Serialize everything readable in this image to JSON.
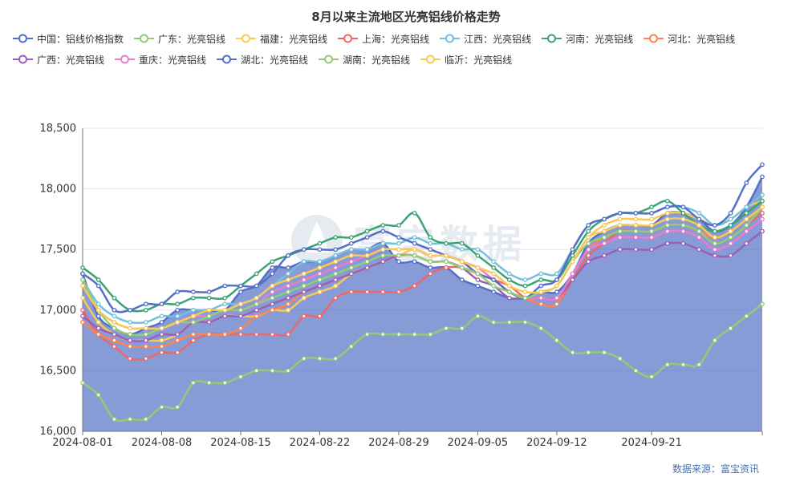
{
  "title": "8月以来主流地区光亮铝线价格走势",
  "source_text": "数据来源：富宝资讯",
  "watermark_text": "富宝数据",
  "chart_data": {
    "type": "line",
    "title": "8月以来主流地区光亮铝线价格走势",
    "xlabel": "",
    "ylabel": "",
    "ylim": [
      16000,
      18500
    ],
    "yticks": [
      16000,
      16500,
      17000,
      17500,
      18000,
      18500
    ],
    "ytick_labels": [
      "16,000",
      "16,500",
      "17,000",
      "17,500",
      "18,000",
      "18,500"
    ],
    "xtick_labels": [
      "2024-08-01",
      "2024-08-08",
      "2024-08-15",
      "2024-08-22",
      "2024-08-29",
      "2024-09-05",
      "2024-09-12",
      "2024-09-21"
    ],
    "xtick_index": [
      0,
      5,
      10,
      15,
      20,
      25,
      30,
      36
    ],
    "grid": true,
    "legend_position": "top",
    "area_series": "中国：铝线价格指数",
    "dates": [
      "2024-08-01",
      "2024-08-02",
      "2024-08-05",
      "2024-08-06",
      "2024-08-07",
      "2024-08-08",
      "2024-08-09",
      "2024-08-12",
      "2024-08-13",
      "2024-08-14",
      "2024-08-15",
      "2024-08-16",
      "2024-08-19",
      "2024-08-20",
      "2024-08-21",
      "2024-08-22",
      "2024-08-23",
      "2024-08-26",
      "2024-08-27",
      "2024-08-28",
      "2024-08-29",
      "2024-08-30",
      "2024-09-02",
      "2024-09-03",
      "2024-09-04",
      "2024-09-05",
      "2024-09-06",
      "2024-09-09",
      "2024-09-10",
      "2024-09-11",
      "2024-09-12",
      "2024-09-13",
      "2024-09-14",
      "2024-09-18",
      "2024-09-19",
      "2024-09-20",
      "2024-09-21",
      "2024-09-23",
      "2024-09-24",
      "2024-09-25",
      "2024-09-26",
      "2024-09-27",
      "2024-09-29",
      "2024-09-30"
    ],
    "series": [
      {
        "name": "中国：铝线价格指数",
        "color": "#5470c6",
        "values": [
          17300,
          16950,
          16850,
          16800,
          16850,
          16900,
          17000,
          17000,
          17000,
          17000,
          17150,
          17200,
          17350,
          17350,
          17400,
          17400,
          17450,
          17500,
          17500,
          17550,
          17400,
          17400,
          17350,
          17350,
          17250,
          17200,
          17150,
          17100,
          17100,
          17150,
          17150,
          17300,
          17550,
          17650,
          17700,
          17700,
          17700,
          17800,
          17800,
          17750,
          17650,
          17700,
          17850,
          18100
        ]
      },
      {
        "name": "广东：光亮铝线",
        "color": "#91cc75",
        "values": [
          16400,
          16300,
          16100,
          16100,
          16100,
          16200,
          16200,
          16400,
          16400,
          16400,
          16450,
          16500,
          16500,
          16500,
          16600,
          16600,
          16600,
          16700,
          16800,
          16800,
          16800,
          16800,
          16800,
          16850,
          16850,
          16950,
          16900,
          16900,
          16900,
          16850,
          16750,
          16650,
          16650,
          16650,
          16600,
          16500,
          16450,
          16550,
          16550,
          16550,
          16750,
          16850,
          16950,
          17050
        ]
      },
      {
        "name": "福建：光亮铝线",
        "color": "#fac858",
        "values": [
          17100,
          16900,
          16800,
          16750,
          16750,
          16750,
          16800,
          16900,
          16900,
          16950,
          16950,
          16950,
          17000,
          17000,
          17100,
          17150,
          17200,
          17300,
          17350,
          17400,
          17450,
          17500,
          17450,
          17450,
          17400,
          17350,
          17300,
          17200,
          17150,
          17150,
          17200,
          17400,
          17600,
          17700,
          17750,
          17750,
          17750,
          17800,
          17800,
          17750,
          17700,
          17750,
          17850,
          17900
        ]
      },
      {
        "name": "上海：光亮铝线",
        "color": "#ee6666",
        "values": [
          17000,
          16800,
          16700,
          16600,
          16600,
          16650,
          16650,
          16750,
          16800,
          16800,
          16800,
          16800,
          16800,
          16800,
          16950,
          16950,
          17100,
          17150,
          17150,
          17150,
          17150,
          17200,
          17300,
          17350,
          17350,
          17300,
          17250,
          17200,
          17100,
          17050,
          17050,
          17250,
          17450,
          17550,
          17650,
          17650,
          17650,
          17700,
          17700,
          17650,
          17550,
          17600,
          17700,
          17800
        ]
      },
      {
        "name": "江西：光亮铝线",
        "color": "#73c0de",
        "values": [
          17250,
          17050,
          16950,
          16900,
          16900,
          16950,
          16950,
          17000,
          17000,
          17050,
          17050,
          17100,
          17200,
          17300,
          17400,
          17400,
          17450,
          17500,
          17500,
          17550,
          17550,
          17600,
          17550,
          17550,
          17500,
          17500,
          17400,
          17300,
          17250,
          17300,
          17300,
          17500,
          17700,
          17750,
          17800,
          17800,
          17800,
          17850,
          17850,
          17800,
          17700,
          17750,
          17850,
          17950
        ]
      },
      {
        "name": "河南：光亮铝线",
        "color": "#3ba272",
        "values": [
          17350,
          17250,
          17100,
          17000,
          17000,
          17050,
          17050,
          17100,
          17100,
          17100,
          17200,
          17300,
          17400,
          17450,
          17500,
          17550,
          17600,
          17600,
          17650,
          17700,
          17700,
          17800,
          17600,
          17550,
          17550,
          17450,
          17350,
          17250,
          17200,
          17250,
          17250,
          17450,
          17650,
          17750,
          17800,
          17800,
          17850,
          17900,
          17800,
          17700,
          17650,
          17700,
          17800,
          17900
        ]
      },
      {
        "name": "河北：光亮铝线",
        "color": "#fc8452",
        "values": [
          16900,
          16800,
          16750,
          16700,
          16700,
          16700,
          16750,
          16800,
          16800,
          16800,
          16850,
          16950,
          17000,
          17050,
          17150,
          17200,
          17250,
          17300,
          17350,
          17400,
          17450,
          17450,
          17400,
          17400,
          17350,
          17300,
          17250,
          17150,
          17100,
          17050,
          17050,
          17300,
          17500,
          17600,
          17650,
          17650,
          17650,
          17700,
          17700,
          17650,
          17600,
          17650,
          17750,
          17850
        ]
      },
      {
        "name": "广西：光亮铝线",
        "color": "#9a60b4",
        "values": [
          16950,
          16850,
          16800,
          16750,
          16750,
          16800,
          16800,
          16900,
          16900,
          16950,
          16950,
          17000,
          17050,
          17100,
          17150,
          17200,
          17250,
          17300,
          17350,
          17400,
          17450,
          17450,
          17400,
          17400,
          17350,
          17250,
          17200,
          17100,
          17100,
          17100,
          17100,
          17250,
          17400,
          17450,
          17500,
          17500,
          17500,
          17550,
          17550,
          17500,
          17450,
          17450,
          17550,
          17650
        ]
      },
      {
        "name": "重庆：光亮铝线",
        "color": "#ea7ccc",
        "values": [
          17200,
          17000,
          16900,
          16850,
          16850,
          16850,
          16900,
          16950,
          16950,
          17000,
          17000,
          17050,
          17150,
          17200,
          17250,
          17300,
          17350,
          17400,
          17450,
          17500,
          17500,
          17500,
          17450,
          17450,
          17400,
          17350,
          17250,
          17150,
          17100,
          17100,
          17100,
          17300,
          17500,
          17550,
          17600,
          17600,
          17600,
          17650,
          17650,
          17600,
          17500,
          17550,
          17650,
          17750
        ]
      },
      {
        "name": "湖北：光亮铝线",
        "color": "#5470c6",
        "values": [
          17300,
          17200,
          17000,
          17000,
          17050,
          17050,
          17150,
          17150,
          17150,
          17200,
          17200,
          17200,
          17300,
          17450,
          17500,
          17500,
          17500,
          17550,
          17600,
          17650,
          17600,
          17550,
          17500,
          17450,
          17400,
          17300,
          17250,
          17150,
          17100,
          17200,
          17250,
          17500,
          17700,
          17750,
          17800,
          17800,
          17800,
          17850,
          17850,
          17750,
          17700,
          17800,
          18050,
          18200
        ]
      },
      {
        "name": "湖南：光亮铝线",
        "color": "#91cc75",
        "values": [
          17250,
          17000,
          16850,
          16800,
          16800,
          16850,
          16900,
          16900,
          16950,
          17000,
          17000,
          17050,
          17100,
          17150,
          17200,
          17250,
          17300,
          17350,
          17400,
          17450,
          17450,
          17450,
          17400,
          17400,
          17350,
          17300,
          17200,
          17150,
          17100,
          17150,
          17200,
          17400,
          17550,
          17600,
          17650,
          17650,
          17650,
          17700,
          17700,
          17650,
          17550,
          17600,
          17700,
          17850
        ]
      },
      {
        "name": "临沂：光亮铝线",
        "color": "#fac858",
        "values": [
          17200,
          17000,
          16900,
          16850,
          16850,
          16850,
          16900,
          16950,
          17000,
          17000,
          17050,
          17100,
          17200,
          17250,
          17300,
          17350,
          17400,
          17450,
          17450,
          17500,
          17500,
          17500,
          17450,
          17450,
          17400,
          17350,
          17300,
          17200,
          17150,
          17150,
          17200,
          17400,
          17600,
          17650,
          17700,
          17700,
          17700,
          17750,
          17750,
          17700,
          17600,
          17650,
          17750,
          17850
        ]
      }
    ]
  }
}
